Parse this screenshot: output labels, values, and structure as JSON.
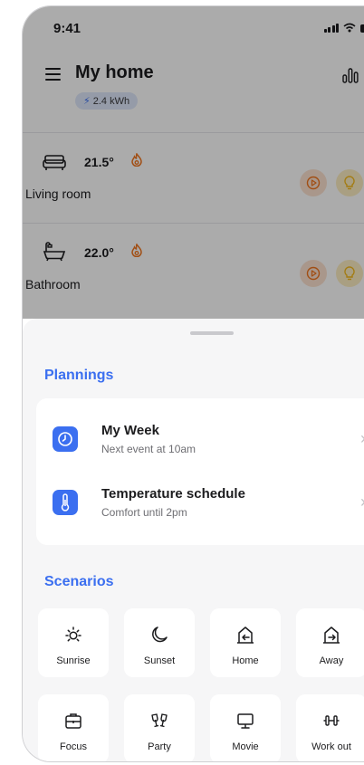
{
  "status_bar": {
    "time": "9:41"
  },
  "header": {
    "title": "My home",
    "energy": "2.4 kWh"
  },
  "rooms": [
    {
      "name": "Living room",
      "temperature": "21.5°",
      "icon": "sofa-icon"
    },
    {
      "name": "Bathroom",
      "temperature": "22.0°",
      "icon": "bathtub-icon"
    }
  ],
  "plannings": {
    "title": "Plannings",
    "items": [
      {
        "title": "My Week",
        "subtitle": "Next event at 10am",
        "icon": "clock-icon"
      },
      {
        "title": "Temperature schedule",
        "subtitle": "Comfort until 2pm",
        "icon": "thermometer-icon"
      }
    ]
  },
  "scenarios": {
    "title": "Scenarios",
    "items": [
      {
        "label": "Sunrise",
        "icon": "sunrise-icon"
      },
      {
        "label": "Sunset",
        "icon": "moon-icon"
      },
      {
        "label": "Home",
        "icon": "home-enter-icon"
      },
      {
        "label": "Away",
        "icon": "home-exit-icon"
      },
      {
        "label": "Focus",
        "icon": "briefcase-icon"
      },
      {
        "label": "Party",
        "icon": "glasses-cheers-icon"
      },
      {
        "label": "Movie",
        "icon": "monitor-icon"
      },
      {
        "label": "Work out",
        "icon": "dumbbell-icon"
      }
    ]
  },
  "colors": {
    "accent": "#3b6ff0",
    "flame": "#f0751f",
    "bulb": "#f3b81a",
    "sheet_background": "#f6f6f7"
  }
}
